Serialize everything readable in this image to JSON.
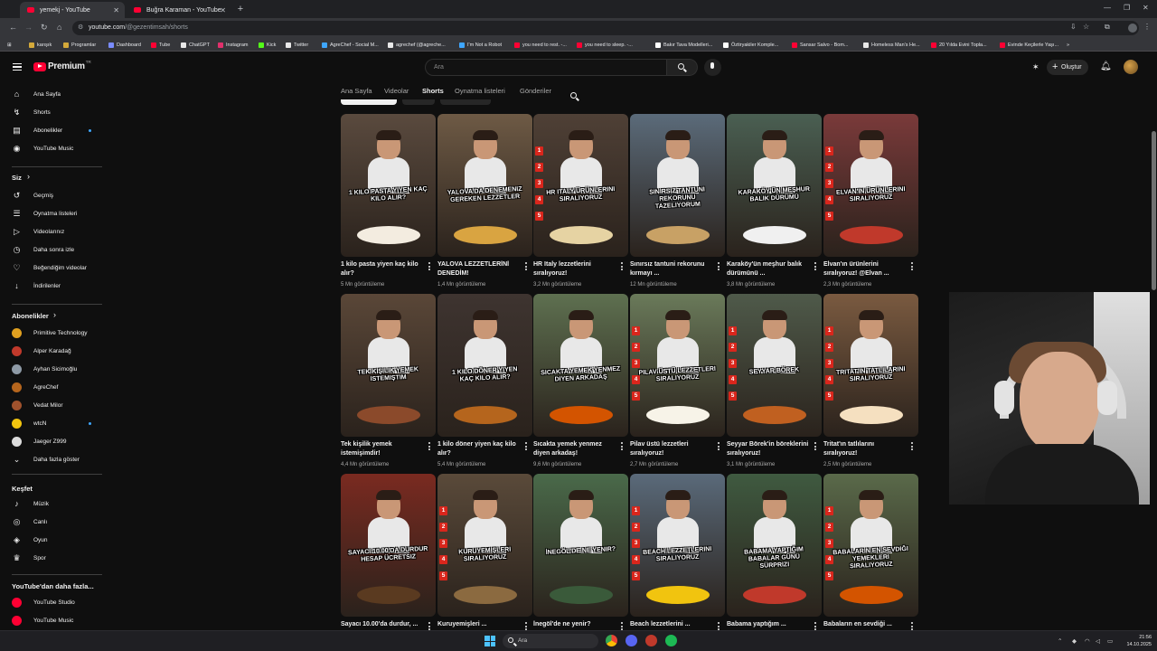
{
  "browser": {
    "tabs": [
      {
        "label": "yemekj - YouTube",
        "active": true
      },
      {
        "label": "Buğra Karaman - YouTube",
        "active": false
      }
    ],
    "url_host": "youtube.com",
    "url_path": "/@gezentimsah/shorts",
    "bookmarks": [
      {
        "label": "karışık",
        "color": "#d4a93a"
      },
      {
        "label": "Programlar",
        "color": "#d4a93a"
      },
      {
        "label": "Dashboard",
        "color": "#7a8cff"
      },
      {
        "label": "Tube",
        "color": "#ff0033"
      },
      {
        "label": "ChatGPT",
        "color": "#e8e8e8"
      },
      {
        "label": "Instagram",
        "color": "#e1306c"
      },
      {
        "label": "Kick",
        "color": "#53fc18"
      },
      {
        "label": "Twitter",
        "color": "#e8e8e8"
      },
      {
        "label": "AgreChef - Social M...",
        "color": "#3ea6ff"
      },
      {
        "label": "agrechef (@agreche...",
        "color": "#e8e8e8"
      },
      {
        "label": "I'm Not a Robot",
        "color": "#3ea6ff"
      },
      {
        "label": "you need to rest. -...",
        "color": "#ff0033"
      },
      {
        "label": "you need to sleep. -...",
        "color": "#ff0033"
      },
      {
        "label": "Bakır Tava Modelleri...",
        "color": "#ffffff"
      },
      {
        "label": "Öztiryakiler Komple...",
        "color": "#ffffff"
      },
      {
        "label": "Sansar Salvo - Bom...",
        "color": "#ff0033"
      },
      {
        "label": "Homeless Man's He...",
        "color": "#e8e8e8"
      },
      {
        "label": "20 Yılda Evini Topla...",
        "color": "#ff0033"
      },
      {
        "label": "Evinde Keçilerle Yaşı...",
        "color": "#ff0033"
      }
    ]
  },
  "youtube": {
    "logo_text": "Premium",
    "logo_country": "TR",
    "search_placeholder": "Ara",
    "create_label": "Oluştur"
  },
  "sidebar": {
    "main": [
      {
        "label": "Ana Sayfa",
        "icon": "home-icon",
        "glyph": "⌂"
      },
      {
        "label": "Shorts",
        "icon": "shorts-icon",
        "glyph": "↯"
      },
      {
        "label": "Abonelikler",
        "icon": "subscriptions-icon",
        "glyph": "▤",
        "dot": true
      },
      {
        "label": "YouTube Music",
        "icon": "music-icon",
        "glyph": "◉"
      }
    ],
    "you_header": "Siz",
    "you": [
      {
        "label": "Geçmiş",
        "icon": "history-icon",
        "glyph": "↺"
      },
      {
        "label": "Oynatma listeleri",
        "icon": "playlists-icon",
        "glyph": "☰"
      },
      {
        "label": "Videolarınız",
        "icon": "your-videos-icon",
        "glyph": "▷"
      },
      {
        "label": "Daha sonra izle",
        "icon": "watch-later-icon",
        "glyph": "◷"
      },
      {
        "label": "Beğendiğim videolar",
        "icon": "like-icon",
        "glyph": "♡"
      },
      {
        "label": "İndirilenler",
        "icon": "download-icon",
        "glyph": "↓"
      }
    ],
    "subs_header": "Abonelikler",
    "subs": [
      {
        "label": "Primitive Technology",
        "color": "#e0a020"
      },
      {
        "label": "Alper Karadağ",
        "color": "#c0392b"
      },
      {
        "label": "Ayhan Sicimoğlu",
        "color": "#8e9aa6"
      },
      {
        "label": "AgreChef",
        "color": "#b5651d"
      },
      {
        "label": "Vedat Milor",
        "color": "#a0522d"
      },
      {
        "label": "wtcN",
        "color": "#f1c40f",
        "dot": true
      },
      {
        "label": "Jaeger Z999",
        "color": "#dcdcdc"
      }
    ],
    "show_more": "Daha fazla göster",
    "explore_header": "Keşfet",
    "explore": [
      {
        "label": "Müzik",
        "icon": "music-note-icon",
        "glyph": "♪"
      },
      {
        "label": "Canlı",
        "icon": "live-icon",
        "glyph": "◎"
      },
      {
        "label": "Oyun",
        "icon": "gaming-icon",
        "glyph": "◈"
      },
      {
        "label": "Spor",
        "icon": "trophy-icon",
        "glyph": "♛"
      }
    ],
    "more_header": "YouTube'dan daha fazla...",
    "more": [
      {
        "label": "YouTube Studio",
        "color": "#ff0033"
      },
      {
        "label": "YouTube Music",
        "color": "#ff0033"
      }
    ]
  },
  "channel_tabs": [
    "Ana Sayfa",
    "Videolar",
    "Shorts",
    "Oynatma listeleri",
    "Gönderiler"
  ],
  "active_tab": "Shorts",
  "shorts": [
    {
      "title": "1 kilo pasta yiyen kaç kilo alır?",
      "views": "5 Mn görüntüleme",
      "caption": "1 kilo pasta yiyen kaç kilo alır?",
      "bg": "#5a4a3e",
      "food": "#f3ece0",
      "ranks": false
    },
    {
      "title": "YALOVA LEZZETLERİNİ DENEDİM!",
      "views": "1,4 Mn görüntüleme",
      "caption": "Yalova'da denemeniz gereken lezzetler",
      "bg": "#6e5a45",
      "food": "#d9a441",
      "ranks": false
    },
    {
      "title": "HR Italy lezzetlerini sıralıyoruz!",
      "views": "3,2 Mn görüntüleme",
      "caption": "HR Italy ürünlerini sıralıyoruz",
      "bg": "#4f4036",
      "food": "#e6d3a3",
      "ranks": true
    },
    {
      "title": "Sınırsız tantuni rekorunu kırmayı ...",
      "views": "12 Mn görüntüleme",
      "caption": "Sınırsız tantuni rekorunu tazeliyorum",
      "bg": "#5b6b7a",
      "food": "#c8a165",
      "ranks": false
    },
    {
      "title": "Karaköy'ün meşhur balık dürümünü ...",
      "views": "3,8 Mn görüntüleme",
      "caption": "Karaköy'ün meşhur balık dürümü",
      "bg": "#4a5f52",
      "food": "#f0f0f0",
      "ranks": false
    },
    {
      "title": "Elvan'ın ürünlerini sıralıyoruz! @Elvan ...",
      "views": "2,3 Mn görüntüleme",
      "caption": "Elvan'ın ürünlerini sıralıyoruz",
      "bg": "#7a3a3a",
      "food": "#c0392b",
      "ranks": true
    },
    {
      "title": "Tek kişilik yemek istemişimdir!",
      "views": "4,4 Mn görüntüleme",
      "caption": "Tek kişilik yemek istemiştim",
      "bg": "#5a4738",
      "food": "#8b4a2b",
      "ranks": false
    },
    {
      "title": "1 kilo döner yiyen kaç kilo alır?",
      "views": "5,4 Mn görüntüleme",
      "caption": "1 kilo döner yiyen kaç kilo alır?",
      "bg": "#3e3430",
      "food": "#b5651d",
      "ranks": false
    },
    {
      "title": "Sıcakta yemek yenmez diyen arkadaş!",
      "views": "9,6 Mn görüntüleme",
      "caption": "Sıcakta yemek yenmez diyen arkadaş",
      "bg": "#5e7050",
      "food": "#d35400",
      "ranks": false
    },
    {
      "title": "Pilav üstü lezzetleri sıralıyoruz!",
      "views": "2,7 Mn görüntüleme",
      "caption": "Pilav üstü lezzetleri sıralıyoruz",
      "bg": "#6a7a5a",
      "food": "#f7f3e8",
      "ranks": true
    },
    {
      "title": "Seyyar Börek'in böreklerini sıralıyoruz!",
      "views": "3,1 Mn görüntüleme",
      "caption": "Seyyar Börek",
      "bg": "#4f5a4a",
      "food": "#c06020",
      "ranks": true
    },
    {
      "title": "Tritat'ın tatlılarını sıralıyoruz!",
      "views": "2,5 Mn görüntüleme",
      "caption": "Tritat'ın tatlılarını sıralıyoruz",
      "bg": "#7a5a40",
      "food": "#f5e0c0",
      "ranks": true
    },
    {
      "title": "Sayacı 10.00'da durdur, ...",
      "views": "",
      "caption": "Sayacı 10.00'da durdur hesap ücretsiz",
      "bg": "#7a2a20",
      "food": "#5a3a20",
      "ranks": false
    },
    {
      "title": "Kuruyemişleri ...",
      "views": "",
      "caption": "Kuruyemişleri sıralıyoruz",
      "bg": "#5a4a3a",
      "food": "#8b6a40",
      "ranks": true
    },
    {
      "title": "İnegöl'de ne yenir?",
      "views": "",
      "caption": "İnegöl'de ne yenir?",
      "bg": "#4a6a4a",
      "food": "#3a5a3a",
      "ranks": false
    },
    {
      "title": "Beach lezzetlerini ...",
      "views": "",
      "caption": "Beach lezzetlerini sıralıyoruz",
      "bg": "#5a6a7a",
      "food": "#f1c40f",
      "ranks": true
    },
    {
      "title": "Babama yaptığım ...",
      "views": "",
      "caption": "Babama yaptığım Babalar Günü sürprizi",
      "bg": "#3f5a40",
      "food": "#c0392b",
      "ranks": false
    },
    {
      "title": "Babaların en sevdiği ...",
      "views": "",
      "caption": "Babaların en sevdiği yemekleri sıralıyoruz",
      "bg": "#5a6a4a",
      "food": "#d35400",
      "ranks": true
    }
  ],
  "taskbar": {
    "search_placeholder": "Ara",
    "time": "21:56",
    "date": "14.10.2025"
  }
}
